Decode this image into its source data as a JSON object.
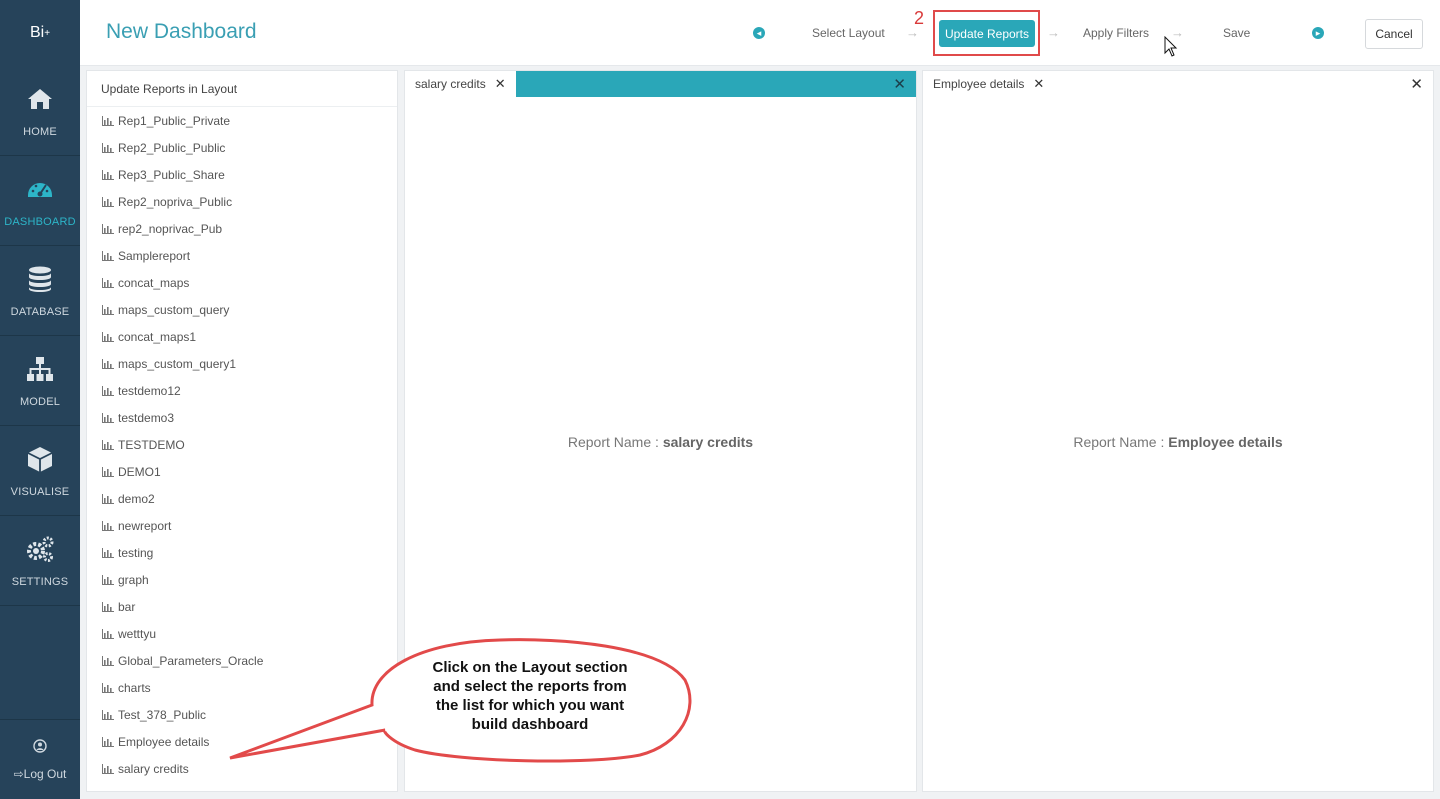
{
  "app": {
    "logo": "Bi",
    "logo_sup": "+"
  },
  "sidebar": {
    "items": [
      {
        "label": "HOME",
        "icon": "home-icon"
      },
      {
        "label": "DASHBOARD",
        "icon": "dashboard-icon"
      },
      {
        "label": "DATABASE",
        "icon": "database-icon"
      },
      {
        "label": "MODEL",
        "icon": "sitemap-icon"
      },
      {
        "label": "VISUALISE",
        "icon": "cube-icon"
      },
      {
        "label": "SETTINGS",
        "icon": "cogs-icon"
      }
    ],
    "active": "DASHBOARD",
    "logout": "Log Out"
  },
  "header": {
    "title": "New Dashboard",
    "steps": [
      "Select Layout",
      "Update Reports",
      "Apply Filters",
      "Save"
    ],
    "active_step": "Update Reports",
    "active_step_number": "2",
    "cancel": "Cancel"
  },
  "list_panel": {
    "title": "Update Reports in Layout",
    "reports": [
      "Rep1_Public_Private",
      "Rep2_Public_Public",
      "Rep3_Public_Share",
      "Rep2_nopriva_Public",
      "rep2_noprivac_Pub",
      "Samplereport",
      "concat_maps",
      "maps_custom_query",
      "concat_maps1",
      "maps_custom_query1",
      "testdemo12",
      "testdemo3",
      "TESTDEMO",
      "DEMO1",
      "demo2",
      "newreport",
      "testing",
      "graph",
      "bar",
      "wetttyu",
      "Global_Parameters_Oracle",
      "charts",
      "Test_378_Public",
      "Employee details",
      "salary credits"
    ]
  },
  "panels": {
    "left": {
      "tab": "salary credits",
      "label": "Report Name : ",
      "name": "salary credits"
    },
    "right": {
      "tab": "Employee details",
      "label": "Report Name : ",
      "name": "Employee details"
    }
  },
  "callout": {
    "lines": [
      "Click on the Layout section",
      "and select the reports from",
      "the list for which you want",
      "build dashboard"
    ]
  },
  "colors": {
    "sidebar": "#26435a",
    "accent": "#2aa7b8",
    "highlight": "#e04a4a"
  }
}
